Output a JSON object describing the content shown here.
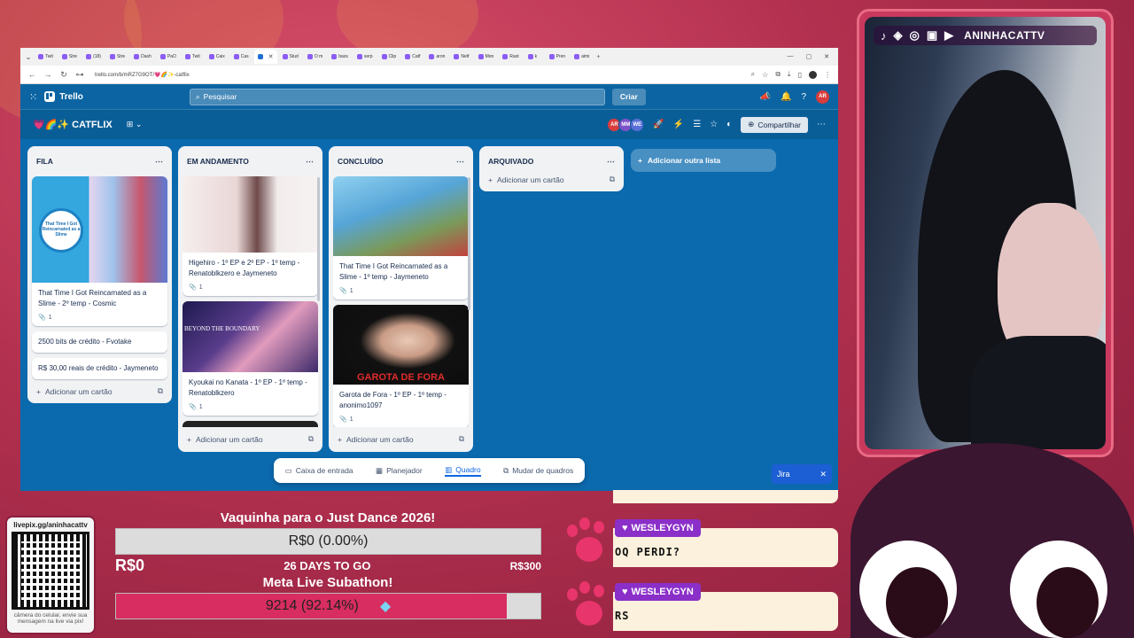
{
  "browser": {
    "tabs": [
      "Twit",
      "Stre",
      "(18)",
      "Stre",
      "Dash",
      "PaO",
      "Twit",
      "Caix",
      "Cas",
      "",
      "Stud",
      "O m",
      "bass",
      "serp",
      "Clip",
      "Catf",
      "aron",
      "Netf",
      "Mon",
      "Rast",
      "k",
      "Pren",
      "aimi"
    ],
    "url": "trello.com/b/mRZ7G9OT/💗🌈✨-catflix"
  },
  "trello": {
    "app_name": "Trello",
    "search_placeholder": "Pesquisar",
    "create_label": "Criar",
    "user_initials": "AR",
    "board_title": "💗🌈✨ CATFLIX",
    "members": [
      {
        "initials": "AR",
        "color": "#d93c3c"
      },
      {
        "initials": "MM",
        "color": "#7d52c9"
      },
      {
        "initials": "WE",
        "color": "#5a6fd6"
      }
    ],
    "share_label": "Compartilhar",
    "add_list_label": "Adicionar outra lista",
    "add_card_label": "Adicionar um cartão",
    "lists": [
      {
        "title": "FILA",
        "cards": [
          {
            "title": "That Time I Got Reincarnated as a Slime - 2º temp - Cosmic",
            "badge": "1",
            "cover": "slime",
            "cover_text": "That Time I Got Reincarnated as a Slime"
          },
          {
            "title": "2500 bits de crédito - Fvotake"
          },
          {
            "title": "R$ 30,00 reais de crédito - Jaymeneto"
          }
        ]
      },
      {
        "title": "EM ANDAMENTO",
        "cards": [
          {
            "title": "Higehiro - 1º EP e 2º EP - 1º temp - Renatoblkzero e Jaymeneto",
            "badge": "1",
            "cover": "higehiro"
          },
          {
            "title": "Kyoukai no Kanata - 1º EP - 1º temp - Renatoblkzero",
            "badge": "1",
            "cover": "kyoukai",
            "cover_text": "BEYOND THE BOUNDARY"
          }
        ]
      },
      {
        "title": "CONCLUÍDO",
        "cards": [
          {
            "title": "That Time I Got Reincarnated as a Slime - 1º temp - Jaymeneto",
            "badge": "1",
            "cover": "slime2"
          },
          {
            "title": "Garota de Fora - 1º EP - 1º temp -anonimo1097",
            "badge": "1",
            "cover": "garota",
            "cover_text": "GAROTA DE FORA"
          }
        ]
      },
      {
        "title": "ARQUIVADO",
        "cards": []
      }
    ],
    "bottom_bar": [
      "Caixa de entrada",
      "Planejador",
      "Quadro",
      "Mudar de quadros"
    ],
    "jira_label": "Jira"
  },
  "stream": {
    "channel": "ANINHACATTV",
    "qr_url": "livepix.gg/aninhacattv",
    "qr_caption": "câmera do celular, envie sua mensagem na live via pix!",
    "goal1": {
      "title": "Vaquinha para o Just Dance 2026!",
      "bar_text": "R$0 (0.00%)",
      "progress": 0.0,
      "start": "R$0",
      "days_left": "26 DAYS TO GO",
      "target": "R$300"
    },
    "goal2": {
      "title": "Meta Live Subathon!",
      "bar_text": "9214 (92.14%)",
      "progress": 0.9214
    },
    "chat": [
      {
        "user": "WESLEYGYN",
        "message": "OQ PERDI?"
      },
      {
        "user": "WESLEYGYN",
        "message": "RS"
      }
    ]
  },
  "colors": {
    "trello_blue": "#0b6aae",
    "accent_pink": "#e8356b",
    "chat_name_bg": "#8b2fc9"
  }
}
